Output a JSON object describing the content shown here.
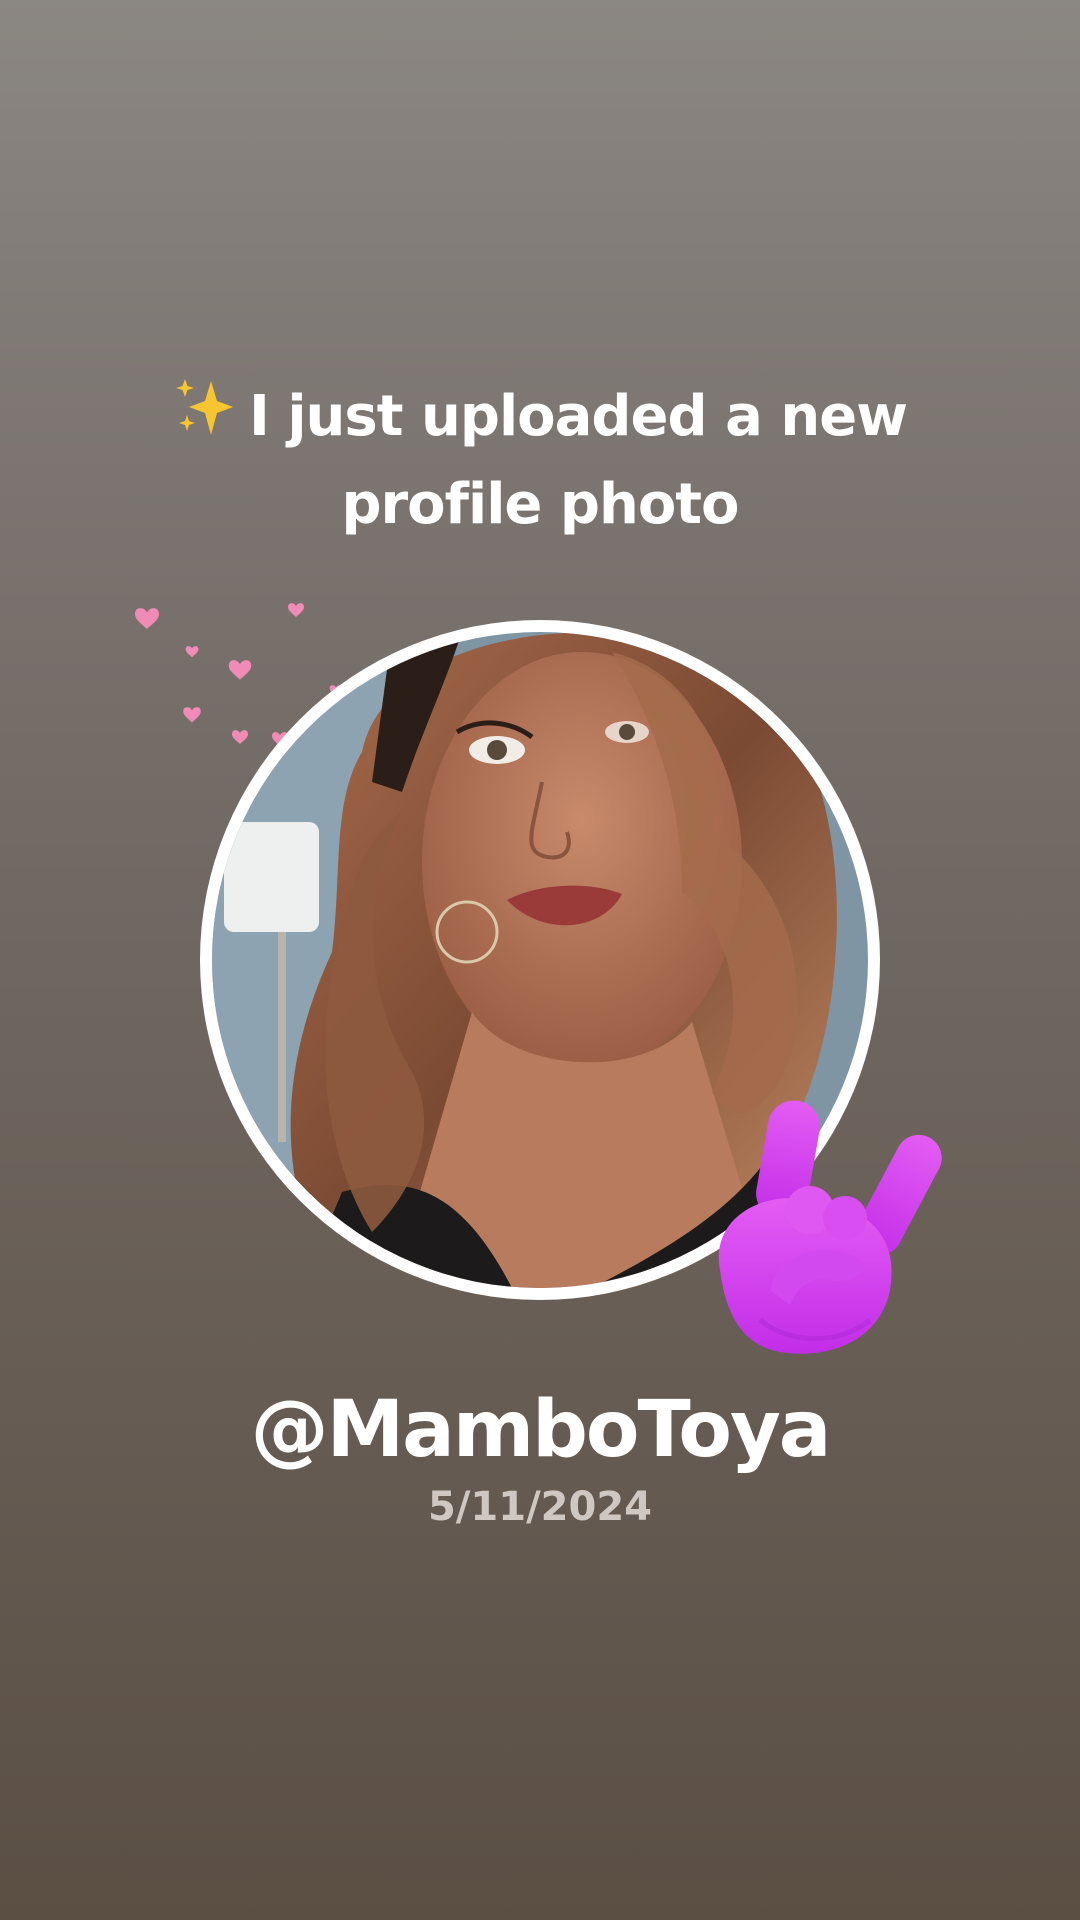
{
  "post": {
    "sparkle_icon": "sparkles-emoji",
    "headline": "I just uploaded a new profile photo",
    "username": "@MamboToya",
    "date": "5/11/2024"
  },
  "decorations": {
    "hearts_icon": "pink-hearts",
    "hand_icon": "rock-on-hand-emoji",
    "heart_color": "#f08ab6",
    "hand_color": "#d83cf0"
  },
  "colors": {
    "background_top": "#8b8782",
    "background_bottom": "#5b4f44",
    "date_text": "#cfc8c2"
  }
}
